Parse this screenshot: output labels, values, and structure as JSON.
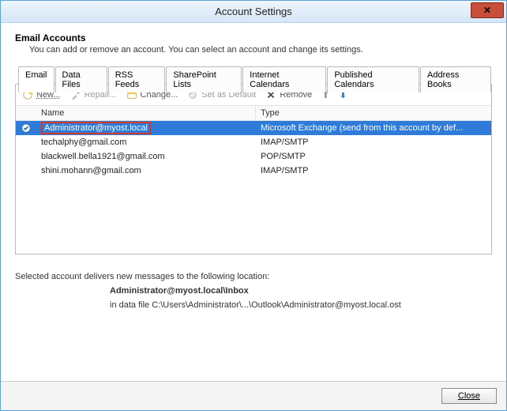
{
  "window": {
    "title": "Account Settings"
  },
  "header": {
    "heading": "Email Accounts",
    "sub": "You can add or remove an account. You can select an account and change its settings."
  },
  "tabs": [
    {
      "label": "Email",
      "active": true
    },
    {
      "label": "Data Files"
    },
    {
      "label": "RSS Feeds"
    },
    {
      "label": "SharePoint Lists"
    },
    {
      "label": "Internet Calendars"
    },
    {
      "label": "Published Calendars"
    },
    {
      "label": "Address Books"
    }
  ],
  "toolbar": {
    "new": "New...",
    "repair": "Repair...",
    "change": "Change...",
    "set_default": "Set as Default",
    "remove": "Remove"
  },
  "columns": {
    "name": "Name",
    "type": "Type"
  },
  "accounts": [
    {
      "name": "Administrator@myost.local",
      "type": "Microsoft Exchange (send from this account by def...",
      "selected": true,
      "default": true
    },
    {
      "name": "techalphy@gmail.com",
      "type": "IMAP/SMTP"
    },
    {
      "name": "blackwell.bella1921@gmail.com",
      "type": "POP/SMTP"
    },
    {
      "name": "shini.mohann@gmail.com",
      "type": "IMAP/SMTP"
    }
  ],
  "info": {
    "lead": "Selected account delivers new messages to the following location:",
    "loc_bold": "Administrator@myost.local\\Inbox",
    "loc_detail": "in data file C:\\Users\\Administrator\\...\\Outlook\\Administrator@myost.local.ost"
  },
  "footer": {
    "close": "Close"
  }
}
